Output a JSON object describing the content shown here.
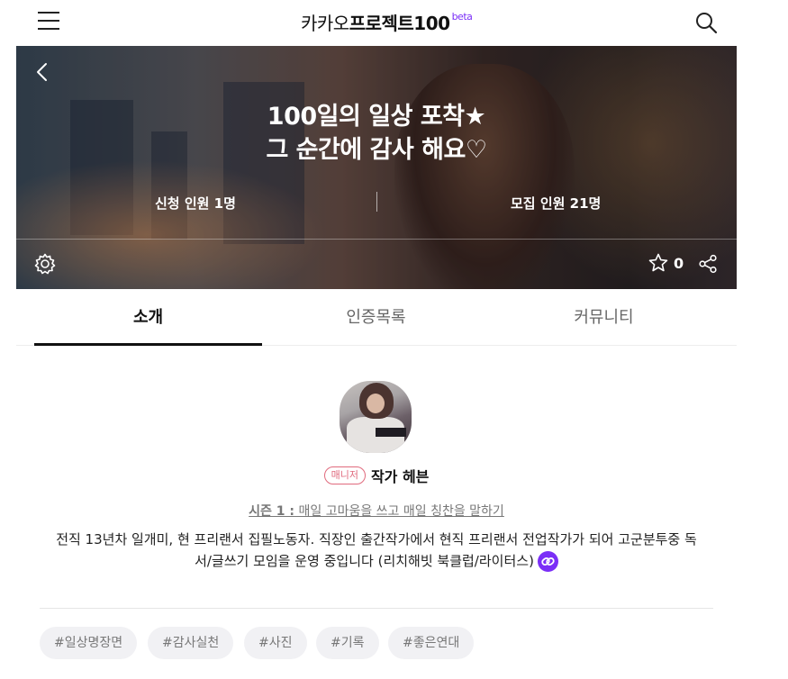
{
  "header": {
    "logo_light": "카카오",
    "logo_bold": "프로젝트100",
    "logo_beta": "beta"
  },
  "hero": {
    "title_line1": "100일의 일상 포착★",
    "title_line2": "그 순간에 감사 해요♡",
    "applicants_label": "신청 인원",
    "applicants_value": "1명",
    "recruit_label": "모집 인원",
    "recruit_value": "21명",
    "star_count": "0"
  },
  "tabs": [
    {
      "label": "소개",
      "active": true
    },
    {
      "label": "인증목록",
      "active": false
    },
    {
      "label": "커뮤니티",
      "active": false
    }
  ],
  "owner": {
    "badge": "매니저",
    "name": "작가 헤븐"
  },
  "season": {
    "prefix": "시즌 1 :",
    "title": "매일 고마움을 쓰고 매일 칭찬을 말하기"
  },
  "description": {
    "line1": "전직 13년차 일개미, 현 프리랜서 집필노동자. 직장인 출간작가에서 현직 프리랜서 전업작가가 되어 고군분투중 독",
    "line2": "서/글쓰기 모임을 운영 중입니다 (리치해빗 북클럽/라이터스)"
  },
  "tags": [
    "#일상명장면",
    "#감사실천",
    "#사진",
    "#기록",
    "#좋은연대"
  ],
  "colors": {
    "accent": "#7b2ff7",
    "badge": "#e06a7d",
    "tag_bg": "#f1f1f4"
  }
}
